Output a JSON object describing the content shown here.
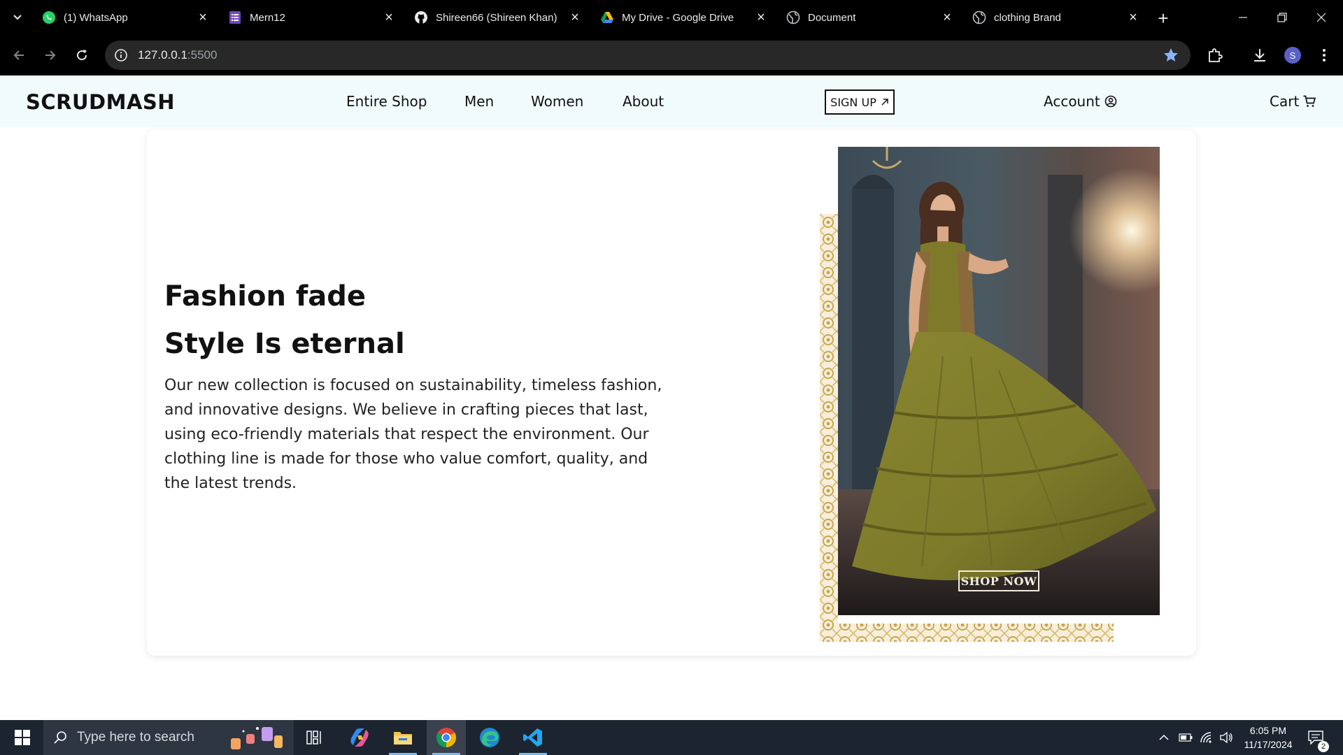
{
  "browser": {
    "tabs": [
      {
        "title": "(1) WhatsApp",
        "icon": "whatsapp-icon"
      },
      {
        "title": "Mern12",
        "icon": "forms-icon"
      },
      {
        "title": "Shireen66 (Shireen Khan)",
        "icon": "github-icon"
      },
      {
        "title": "My Drive - Google Drive",
        "icon": "google-drive-icon"
      },
      {
        "title": "Document",
        "icon": "globe-icon"
      },
      {
        "title": "clothing Brand",
        "icon": "globe-icon"
      }
    ],
    "active_tab_index": 5,
    "url_host": "127.0.0.1",
    "url_port": ":5500",
    "profile_initial": "S"
  },
  "site": {
    "logo": "SCRUDMASH",
    "nav": [
      "Entire Shop",
      "Men",
      "Women",
      "About"
    ],
    "signup_label": "SIGN UP",
    "account_label": "Account",
    "cart_label": "Cart"
  },
  "hero": {
    "heading_line1": "Fashion fade",
    "heading_line2": "Style Is eternal",
    "description": "Our new collection is focused on sustainability, timeless fashion, and innovative designs. We believe in crafting pieces that last, using eco-friendly materials that respect the environment. Our clothing line is made for those who value comfort, quality, and the latest trends.",
    "image_button": "SHOP NOW"
  },
  "taskbar": {
    "search_placeholder": "Type here to search",
    "time": "6:05 PM",
    "date": "11/17/2024",
    "notification_count": "2",
    "apps": [
      "task-view-icon",
      "copilot-icon",
      "file-explorer-icon",
      "chrome-icon",
      "edge-icon",
      "vscode-icon"
    ]
  },
  "colors": {
    "header_bg": "#f1fbfc",
    "chrome_bg": "#000000",
    "omnibox_bg": "#282828",
    "taskbar_bg": "#1c2430",
    "dress": "#7d7a2a",
    "frame_gold": "#c9a64c"
  }
}
